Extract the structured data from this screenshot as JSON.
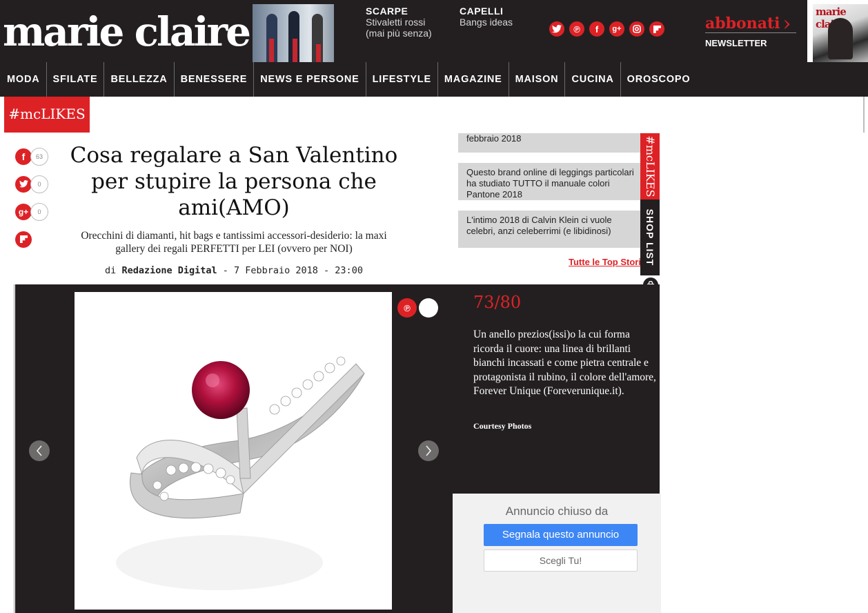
{
  "header": {
    "logo": "marie claire",
    "promo1": {
      "title": "SCARPE",
      "line1": "Stivaletti rossi",
      "line2": "(mai più senza)"
    },
    "promo2": {
      "title": "CAPELLI",
      "line1": "Bangs ideas"
    },
    "social_icons": [
      "twitter-icon",
      "pinterest-icon",
      "facebook-icon",
      "google-plus-icon",
      "instagram-icon",
      "flipboard-icon"
    ],
    "abbonati": "abbonati",
    "newsletter": "NEWSLETTER",
    "magazine_title": "marie claire"
  },
  "nav": [
    "MODA",
    "SFILATE",
    "BELLEZZA",
    "BENESSERE",
    "NEWS E PERSONE",
    "LIFESTYLE",
    "MAGAZINE",
    "MAISON",
    "CUCINA",
    "OROSCOPO"
  ],
  "mclikes": "#mcLIKES",
  "share": {
    "facebook_count": "63",
    "twitter_count": "0",
    "gplus_count": "0"
  },
  "article": {
    "title": "Cosa regalare a San Valentino per stupire la persona che ami(AMO)",
    "subtitle": "Orecchini di diamanti, hit bags e tantissimi accessori-desiderio: la maxi gallery dei regali PERFETTI per LEI (ovvero per NOI)",
    "by": "di",
    "author": "Redazione Digital",
    "date": " - 7 Febbraio 2018 - 23:00"
  },
  "top_stories": [
    "febbraio 2018",
    "Questo brand online di leggings particolari ha studiato TUTTO il manuale colori Pantone 2018",
    "L'intimo 2018 di Calvin Klein ci vuole celebri, anzi celeberrimi (e libidinosi)"
  ],
  "tutte": "Tutte le Top Stories",
  "tabs": {
    "mclikes": "#mcLIKES",
    "shop": "SHOP LIST"
  },
  "gallery": {
    "counter": "73/80",
    "caption": "Un anello prezios(issi)o la cui forma ricorda il cuore: una linea di brillanti bianchi incassati e come pietra centrale e protagonista il rubino, il colore dell'amore, Forever Unique (Foreverunique.it).",
    "courtesy": "Courtesy Photos"
  },
  "ad": {
    "title": "Annuncio chiuso da",
    "report": "Segnala questo annuncio",
    "choose": "Scegli Tu!"
  },
  "colors": {
    "brand_red": "#dd2226",
    "dark": "#231f20",
    "ad_blue": "#3d86f5"
  }
}
